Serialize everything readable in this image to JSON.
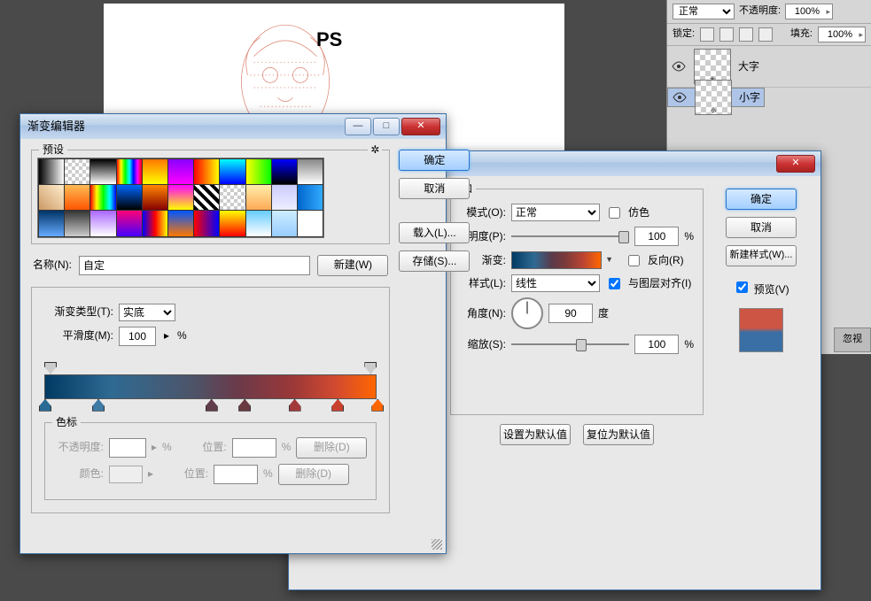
{
  "canvas": {
    "text": "PS"
  },
  "layers": {
    "blend_label": "正常",
    "opacity_label": "不透明度:",
    "opacity_val": "100%",
    "lock_label": "锁定:",
    "fill_label": "填充:",
    "fill_val": "100%",
    "items": [
      {
        "name": "大字"
      },
      {
        "name": "小字"
      }
    ],
    "ignore": "忽视"
  },
  "style_dlg": {
    "title": "加",
    "btn_ok": "确定",
    "btn_cancel": "取消",
    "btn_newstyle": "新建样式(W)...",
    "chk_preview": "预览(V)",
    "mode_label": "模式(O):",
    "mode_val": "正常",
    "dither": "仿色",
    "opacity_label": "明度(P):",
    "opacity_val": "100",
    "pct": "%",
    "grad_label": "渐变:",
    "reverse": "反向(R)",
    "style_label": "样式(L):",
    "style_val": "线性",
    "align": "与图层对齐(I)",
    "angle_label": "角度(N):",
    "angle_val": "90",
    "deg": "度",
    "scale_label": "缩放(S):",
    "scale_val": "100",
    "btn_default": "设置为默认值",
    "btn_reset": "复位为默认值"
  },
  "grad_dlg": {
    "title": "渐变编辑器",
    "presets_label": "预设",
    "btn_ok": "确定",
    "btn_cancel": "取消",
    "btn_load": "载入(L)...",
    "btn_save": "存储(S)...",
    "name_label": "名称(N):",
    "name_val": "自定",
    "btn_new": "新建(W)",
    "type_label": "渐变类型(T):",
    "type_val": "实底",
    "smooth_label": "平滑度(M):",
    "smooth_val": "100",
    "pct": "%",
    "stops_label": "色标",
    "op_label": "不透明度:",
    "pos_label": "位置:",
    "delete": "删除(D)",
    "color_label": "颜色:"
  },
  "presets": [
    "linear-gradient(90deg,#000,#fff)",
    "repeating-conic-gradient(#fff 0 25%,#ccc 0 50%) 0 0/8px 8px",
    "linear-gradient(#000,#fff)",
    "linear-gradient(90deg,red,#ff0,#0f0,#0ff,#00f,#f0f,red)",
    "linear-gradient(#f70,#ff0)",
    "linear-gradient(#80f,#f0f)",
    "linear-gradient(90deg,#f00,#ff0)",
    "linear-gradient(#0ff,#00f)",
    "linear-gradient(90deg,#ff0,#0f0)",
    "linear-gradient(#00f,#000)",
    "linear-gradient(#888,#fff)",
    "linear-gradient(45deg,#c96,#fec)",
    "linear-gradient(#fb5,#f50)",
    "linear-gradient(90deg,red,#ff0,#0f0,#0ff,#00f)",
    "linear-gradient(#06f,#000)",
    "linear-gradient(#f80,#800)",
    "linear-gradient(#f0f,#ff0)",
    "repeating-linear-gradient(45deg,#000 0 4px,#fff 4px 8px)",
    "repeating-conic-gradient(#fff 0 25%,#ccc 0 50%) 0 0/8px 8px",
    "linear-gradient(#fea,#fa5)",
    "linear-gradient(#ccf,#eef)",
    "linear-gradient(90deg,#06c,#3af)",
    "linear-gradient(#036,#6af)",
    "linear-gradient(#333,#ccc)",
    "linear-gradient(#a6f,#fff)",
    "linear-gradient(#f07,#40f)",
    "linear-gradient(90deg,#00f,#f00,#ff0)",
    "linear-gradient(#05f,#f70)",
    "linear-gradient(90deg,#f00,#00f)",
    "linear-gradient(#ff0,#f00)",
    "linear-gradient(#6cf,#fff)",
    "linear-gradient(#cef,#9cf)",
    "#fff"
  ],
  "bot_stops": [
    0,
    16,
    50,
    60,
    75,
    88,
    100
  ]
}
